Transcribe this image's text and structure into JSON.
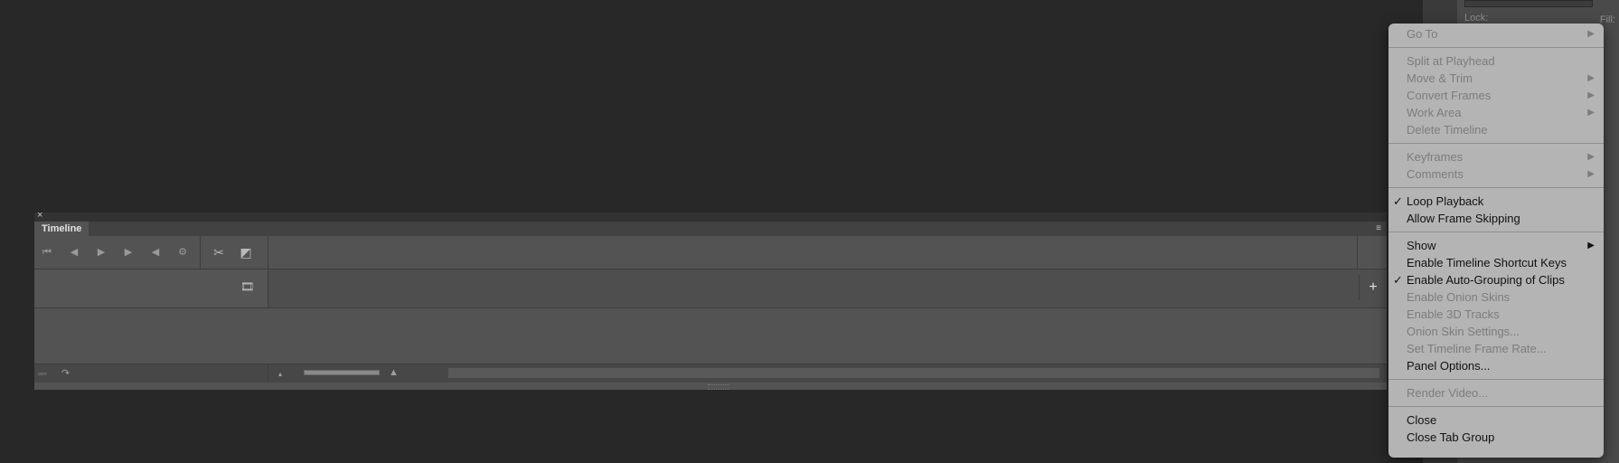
{
  "right_panel": {
    "lock_label": "Lock:",
    "fill_label": "Fill:"
  },
  "timeline": {
    "close_glyph": "×",
    "tab_label": "Timeline",
    "add_glyph": "+",
    "icons": {
      "first_frame": "⏮",
      "prev_frame": "◀",
      "play": "▶",
      "next_frame": "▶",
      "audio": "◀",
      "settings": "⚙",
      "cut": "✂",
      "transition": "◩",
      "film": "🎞",
      "convert_frames": "▫▫▫",
      "render": "↷",
      "zoom_out": "▴",
      "zoom_in": "▲",
      "panel_menu": "≡"
    }
  },
  "menu": {
    "items": [
      {
        "label": "Go To",
        "enabled": false,
        "checked": false,
        "submenu": true
      },
      {
        "separator": true
      },
      {
        "label": "Split at Playhead",
        "enabled": false,
        "checked": false,
        "submenu": false
      },
      {
        "label": "Move & Trim",
        "enabled": false,
        "checked": false,
        "submenu": true
      },
      {
        "label": "Convert Frames",
        "enabled": false,
        "checked": false,
        "submenu": true
      },
      {
        "label": "Work Area",
        "enabled": false,
        "checked": false,
        "submenu": true
      },
      {
        "label": "Delete Timeline",
        "enabled": false,
        "checked": false,
        "submenu": false
      },
      {
        "separator": true
      },
      {
        "label": "Keyframes",
        "enabled": false,
        "checked": false,
        "submenu": true
      },
      {
        "label": "Comments",
        "enabled": false,
        "checked": false,
        "submenu": true
      },
      {
        "separator": true
      },
      {
        "label": "Loop Playback",
        "enabled": true,
        "checked": true,
        "submenu": false
      },
      {
        "label": "Allow Frame Skipping",
        "enabled": true,
        "checked": false,
        "submenu": false
      },
      {
        "separator": true
      },
      {
        "label": "Show",
        "enabled": true,
        "checked": false,
        "submenu": true
      },
      {
        "label": "Enable Timeline Shortcut Keys",
        "enabled": true,
        "checked": false,
        "submenu": false
      },
      {
        "label": "Enable Auto-Grouping of Clips",
        "enabled": true,
        "checked": true,
        "submenu": false
      },
      {
        "label": "Enable Onion Skins",
        "enabled": false,
        "checked": false,
        "submenu": false
      },
      {
        "label": "Enable 3D Tracks",
        "enabled": false,
        "checked": false,
        "submenu": false
      },
      {
        "label": "Onion Skin Settings...",
        "enabled": false,
        "checked": false,
        "submenu": false
      },
      {
        "label": "Set Timeline Frame Rate...",
        "enabled": false,
        "checked": false,
        "submenu": false
      },
      {
        "label": "Panel Options...",
        "enabled": true,
        "checked": false,
        "submenu": false
      },
      {
        "separator": true
      },
      {
        "label": "Render Video...",
        "enabled": false,
        "checked": false,
        "submenu": false
      },
      {
        "separator": true
      },
      {
        "label": "Close",
        "enabled": true,
        "checked": false,
        "submenu": false
      },
      {
        "label": "Close Tab Group",
        "enabled": true,
        "checked": false,
        "submenu": false
      }
    ],
    "check_glyph": "✓",
    "arrow_glyph": "▶"
  },
  "colors": {
    "background": "#282828",
    "panel": "#535353",
    "menu_bg": "#b4b4b4",
    "menu_text_enabled": "#111111",
    "menu_text_disabled": "#7c7c7c"
  }
}
